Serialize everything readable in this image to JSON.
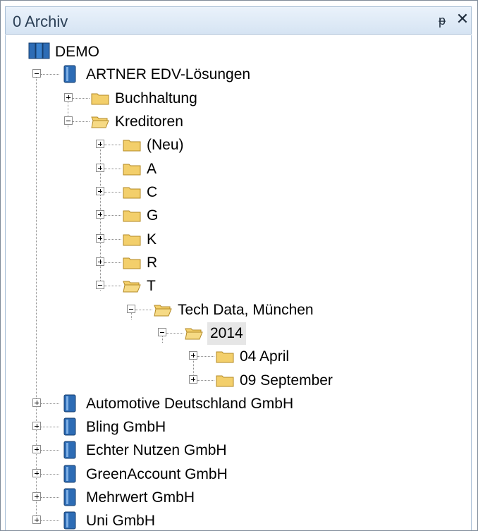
{
  "panel": {
    "title": "0 Archiv",
    "pin_symbol": "ᵽ",
    "close_symbol": "✕"
  },
  "tree": {
    "root": "DEMO",
    "company_expanded": "ARTNER EDV-Lösungen",
    "folders": {
      "buchhaltung": "Buchhaltung",
      "kreditoren": "Kreditoren",
      "neu": "(Neu)",
      "a": "A",
      "c": "C",
      "g": "G",
      "k": "K",
      "r": "R",
      "t": "T",
      "techdata": "Tech Data, München",
      "year2014": "2014",
      "april": "04 April",
      "september": "09 September"
    },
    "other_companies": [
      "Automotive Deutschland GmbH",
      "Bling GmbH",
      "Echter Nutzen GmbH",
      "GreenAccount GmbH",
      "Mehrwert GmbH",
      "Uni GmbH"
    ]
  },
  "colors": {
    "folder": "#f3cf6b",
    "book_blue": "#2d6cb5",
    "title_text": "#2b3f55"
  }
}
